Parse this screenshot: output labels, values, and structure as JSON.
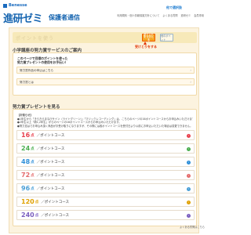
{
  "brand": {
    "text": "Benesse"
  },
  "header": {
    "logo": "進研ゼミ",
    "site_name": "保護者通信",
    "links": [
      "利用規約・個人情報保護方針について",
      "よくある質問",
      "進研ゼミ",
      "会員専用"
    ]
  },
  "hero": {
    "faded_text": "ポイントを使う",
    "receive_button": "ポイントをうけとる",
    "other_button": "他のポイント",
    "annotation_left": "受けとりをする",
    "annotation_right": "他で選択肢"
  },
  "section1": {
    "title": "小学講座の努力賞サービスのご案内",
    "line1": "このページで目標のポイントを使った",
    "line2": "努力賞プレゼントの使用をお手伝い！",
    "row1": "努力賞作品の申込はこちら",
    "row2": "努力賞とは"
  },
  "section2": {
    "title": "努力賞プレゼントを見る",
    "notes": [
      "【お知らせ】",
      "●1年生から「きらきらまなびサイン（ライトグリーン）」「マジックレコーディング」は、こちらのページの16ポイントコースからお申込みいただけます。",
      "●2年生以上「新1,2年生」からのページの16ポイントコースからお申込みいただけます。",
      "●努力賞はでお申込み頂く商品がお受け取りになりますが、その際には各ポイントコースを受付日より以前にお申込いただいた場合は変更できません。"
    ],
    "courses": [
      {
        "number": "16",
        "unit": "点",
        "label": "／ポイントコース",
        "color": "#e8414d"
      },
      {
        "number": "24",
        "unit": "点",
        "label": "／ポイントコース",
        "color": "#4cae4f"
      },
      {
        "number": "48",
        "unit": "点",
        "label": "／ポイントコース",
        "color": "#2f8fd8"
      },
      {
        "number": "72",
        "unit": "点",
        "label": "／ポイントコース",
        "color": "#e46b6b"
      },
      {
        "number": "96",
        "unit": "点",
        "label": "／ポイントコース",
        "color": "#4a9fd6"
      },
      {
        "number": "120",
        "unit": "点",
        "label": "／ポイントコース",
        "color": "#e0a100"
      },
      {
        "number": "240",
        "unit": "点",
        "label": "／ポイントコース",
        "color": "#7b5fc0"
      }
    ],
    "course_arrow": "›"
  },
  "footer": {
    "faq": "よくある質問はこちら"
  }
}
